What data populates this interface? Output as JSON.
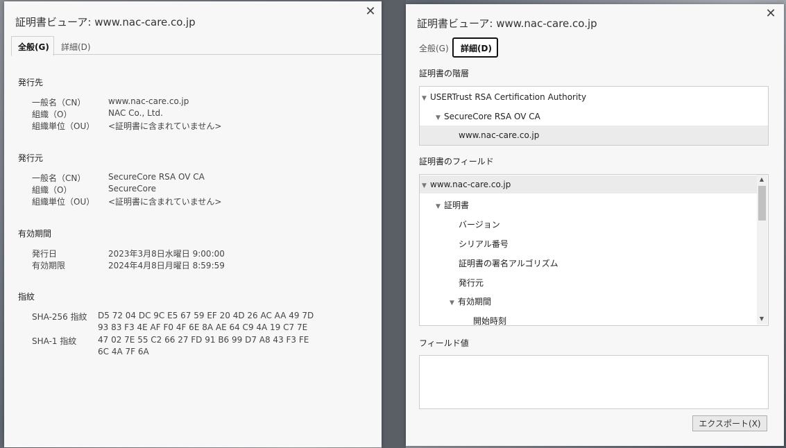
{
  "general_dialog": {
    "title": "証明書ビューア: www.nac-care.co.jp",
    "close_label": "✕",
    "tabs": [
      {
        "label": "全般(G)",
        "active": true
      },
      {
        "label": "詳細(D)",
        "active": false
      }
    ],
    "sections": [
      {
        "heading": "発行先",
        "rows": [
          {
            "label": "一般名（CN）",
            "value": "www.nac-care.co.jp"
          },
          {
            "label": "組織（O）",
            "value": "NAC Co., Ltd."
          },
          {
            "label": "組織単位（OU）",
            "value": "<証明書に含まれていません>"
          }
        ]
      },
      {
        "heading": "発行元",
        "rows": [
          {
            "label": "一般名（CN）",
            "value": "SecureCore RSA OV CA"
          },
          {
            "label": "組織（O）",
            "value": "SecureCore"
          },
          {
            "label": "組織単位（OU）",
            "value": "<証明書に含まれていません>"
          }
        ]
      },
      {
        "heading": "有効期間",
        "rows": [
          {
            "label": "発行日",
            "value": "2023年3月8日水曜日 9:00:00"
          },
          {
            "label": "有効期限",
            "value": "2024年4月8日月曜日 8:59:59"
          }
        ]
      },
      {
        "heading": "指紋",
        "rows": [
          {
            "label": "SHA-256 指紋",
            "value_line1": "D5 72 04 DC 9C E5 67 59 EF 20 4D 26 AC AA 49 7D",
            "value_line2": "93 83 F3 4E AF F0 4F 6E 8A AE 64 C9 4A 19 C7 7E"
          },
          {
            "label": "SHA-1 指紋",
            "value_line1": "47 02 7E 55 C2 66 27 FD 91 B6 99 D7 A8 43 F3 FE",
            "value_line2": "6C 4A 7F 6A"
          }
        ]
      }
    ]
  },
  "details_dialog": {
    "title": "証明書ビューア: www.nac-care.co.jp",
    "close_label": "✕",
    "tabs": [
      {
        "label": "全般(G)",
        "active": false
      },
      {
        "label": "詳細(D)",
        "active": true
      }
    ],
    "hierarchy_heading": "証明書の階層",
    "hierarchy": [
      {
        "label": "USERTrust RSA Certification Authority",
        "expanded": true
      },
      {
        "label": "SecureCore RSA OV CA",
        "expanded": true
      },
      {
        "label": "www.nac-care.co.jp",
        "selected": true
      }
    ],
    "fields_heading": "証明書のフィールド",
    "fields": [
      {
        "label": "www.nac-care.co.jp",
        "expanded": true,
        "selected": true
      },
      {
        "label": "証明書",
        "expanded": true
      },
      {
        "label": "バージョン"
      },
      {
        "label": "シリアル番号"
      },
      {
        "label": "証明書の署名アルゴリズム"
      },
      {
        "label": "発行元"
      },
      {
        "label": "有効期間",
        "expanded": true
      },
      {
        "label": "開始時刻"
      }
    ],
    "field_value_heading": "フィールド値",
    "field_value": "",
    "export_label": "エクスポート(X)"
  }
}
